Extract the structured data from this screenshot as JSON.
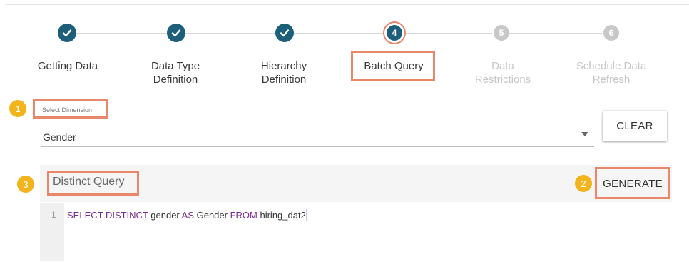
{
  "stepper": {
    "steps": [
      {
        "number": "1",
        "label": "Getting Data",
        "status": "completed"
      },
      {
        "number": "2",
        "label": "Data Type Definition",
        "status": "completed"
      },
      {
        "number": "3",
        "label": "Hierarchy Definition",
        "status": "completed"
      },
      {
        "number": "4",
        "label": "Batch Query",
        "status": "active"
      },
      {
        "number": "5",
        "label": "Data Restrictions",
        "status": "pending"
      },
      {
        "number": "6",
        "label": "Schedule Data Refresh",
        "status": "pending"
      }
    ],
    "line1": {
      "s2": "Data Type",
      "s3": "Hierarchy",
      "s5": "Data",
      "s6": "Schedule Data"
    },
    "line2": {
      "s2": "Definition",
      "s3": "Definition",
      "s5": "Restrictions",
      "s6": "Refresh"
    }
  },
  "markers": {
    "m1": "1",
    "m2": "2",
    "m3": "3"
  },
  "dimension": {
    "label": "Select Dimension",
    "value": "Gender",
    "clear_label": "CLEAR"
  },
  "query": {
    "title": "Distinct Query",
    "generate_label": "GENERATE",
    "line_number": "1",
    "code": {
      "kw1": "SELECT DISTINCT",
      "t1": " gender ",
      "kw2": "AS",
      "t2": " Gender ",
      "kw3": "FROM",
      "t3": " hiring_dat2"
    }
  },
  "colors": {
    "step_completed": "#1d5f7a",
    "step_pending": "#c8c8c8",
    "highlight_box": "#e8876a",
    "marker": "#f2b41d",
    "sql_keyword": "#7a2b8f"
  },
  "icons": {
    "completed_step": "check-icon",
    "dropdown": "caret-down-icon"
  }
}
